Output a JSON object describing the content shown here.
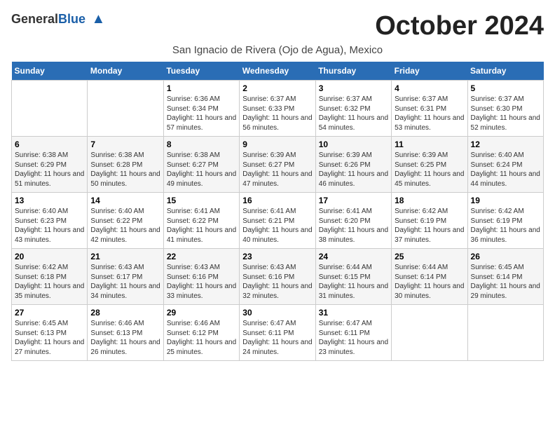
{
  "header": {
    "logo_general": "General",
    "logo_blue": "Blue",
    "month_title": "October 2024",
    "location": "San Ignacio de Rivera (Ojo de Agua), Mexico"
  },
  "days_of_week": [
    "Sunday",
    "Monday",
    "Tuesday",
    "Wednesday",
    "Thursday",
    "Friday",
    "Saturday"
  ],
  "weeks": [
    [
      {
        "day": "",
        "detail": ""
      },
      {
        "day": "",
        "detail": ""
      },
      {
        "day": "1",
        "detail": "Sunrise: 6:36 AM\nSunset: 6:34 PM\nDaylight: 11 hours and 57 minutes."
      },
      {
        "day": "2",
        "detail": "Sunrise: 6:37 AM\nSunset: 6:33 PM\nDaylight: 11 hours and 56 minutes."
      },
      {
        "day": "3",
        "detail": "Sunrise: 6:37 AM\nSunset: 6:32 PM\nDaylight: 11 hours and 54 minutes."
      },
      {
        "day": "4",
        "detail": "Sunrise: 6:37 AM\nSunset: 6:31 PM\nDaylight: 11 hours and 53 minutes."
      },
      {
        "day": "5",
        "detail": "Sunrise: 6:37 AM\nSunset: 6:30 PM\nDaylight: 11 hours and 52 minutes."
      }
    ],
    [
      {
        "day": "6",
        "detail": "Sunrise: 6:38 AM\nSunset: 6:29 PM\nDaylight: 11 hours and 51 minutes."
      },
      {
        "day": "7",
        "detail": "Sunrise: 6:38 AM\nSunset: 6:28 PM\nDaylight: 11 hours and 50 minutes."
      },
      {
        "day": "8",
        "detail": "Sunrise: 6:38 AM\nSunset: 6:27 PM\nDaylight: 11 hours and 49 minutes."
      },
      {
        "day": "9",
        "detail": "Sunrise: 6:39 AM\nSunset: 6:27 PM\nDaylight: 11 hours and 47 minutes."
      },
      {
        "day": "10",
        "detail": "Sunrise: 6:39 AM\nSunset: 6:26 PM\nDaylight: 11 hours and 46 minutes."
      },
      {
        "day": "11",
        "detail": "Sunrise: 6:39 AM\nSunset: 6:25 PM\nDaylight: 11 hours and 45 minutes."
      },
      {
        "day": "12",
        "detail": "Sunrise: 6:40 AM\nSunset: 6:24 PM\nDaylight: 11 hours and 44 minutes."
      }
    ],
    [
      {
        "day": "13",
        "detail": "Sunrise: 6:40 AM\nSunset: 6:23 PM\nDaylight: 11 hours and 43 minutes."
      },
      {
        "day": "14",
        "detail": "Sunrise: 6:40 AM\nSunset: 6:22 PM\nDaylight: 11 hours and 42 minutes."
      },
      {
        "day": "15",
        "detail": "Sunrise: 6:41 AM\nSunset: 6:22 PM\nDaylight: 11 hours and 41 minutes."
      },
      {
        "day": "16",
        "detail": "Sunrise: 6:41 AM\nSunset: 6:21 PM\nDaylight: 11 hours and 40 minutes."
      },
      {
        "day": "17",
        "detail": "Sunrise: 6:41 AM\nSunset: 6:20 PM\nDaylight: 11 hours and 38 minutes."
      },
      {
        "day": "18",
        "detail": "Sunrise: 6:42 AM\nSunset: 6:19 PM\nDaylight: 11 hours and 37 minutes."
      },
      {
        "day": "19",
        "detail": "Sunrise: 6:42 AM\nSunset: 6:19 PM\nDaylight: 11 hours and 36 minutes."
      }
    ],
    [
      {
        "day": "20",
        "detail": "Sunrise: 6:42 AM\nSunset: 6:18 PM\nDaylight: 11 hours and 35 minutes."
      },
      {
        "day": "21",
        "detail": "Sunrise: 6:43 AM\nSunset: 6:17 PM\nDaylight: 11 hours and 34 minutes."
      },
      {
        "day": "22",
        "detail": "Sunrise: 6:43 AM\nSunset: 6:16 PM\nDaylight: 11 hours and 33 minutes."
      },
      {
        "day": "23",
        "detail": "Sunrise: 6:43 AM\nSunset: 6:16 PM\nDaylight: 11 hours and 32 minutes."
      },
      {
        "day": "24",
        "detail": "Sunrise: 6:44 AM\nSunset: 6:15 PM\nDaylight: 11 hours and 31 minutes."
      },
      {
        "day": "25",
        "detail": "Sunrise: 6:44 AM\nSunset: 6:14 PM\nDaylight: 11 hours and 30 minutes."
      },
      {
        "day": "26",
        "detail": "Sunrise: 6:45 AM\nSunset: 6:14 PM\nDaylight: 11 hours and 29 minutes."
      }
    ],
    [
      {
        "day": "27",
        "detail": "Sunrise: 6:45 AM\nSunset: 6:13 PM\nDaylight: 11 hours and 27 minutes."
      },
      {
        "day": "28",
        "detail": "Sunrise: 6:46 AM\nSunset: 6:13 PM\nDaylight: 11 hours and 26 minutes."
      },
      {
        "day": "29",
        "detail": "Sunrise: 6:46 AM\nSunset: 6:12 PM\nDaylight: 11 hours and 25 minutes."
      },
      {
        "day": "30",
        "detail": "Sunrise: 6:47 AM\nSunset: 6:11 PM\nDaylight: 11 hours and 24 minutes."
      },
      {
        "day": "31",
        "detail": "Sunrise: 6:47 AM\nSunset: 6:11 PM\nDaylight: 11 hours and 23 minutes."
      },
      {
        "day": "",
        "detail": ""
      },
      {
        "day": "",
        "detail": ""
      }
    ]
  ]
}
